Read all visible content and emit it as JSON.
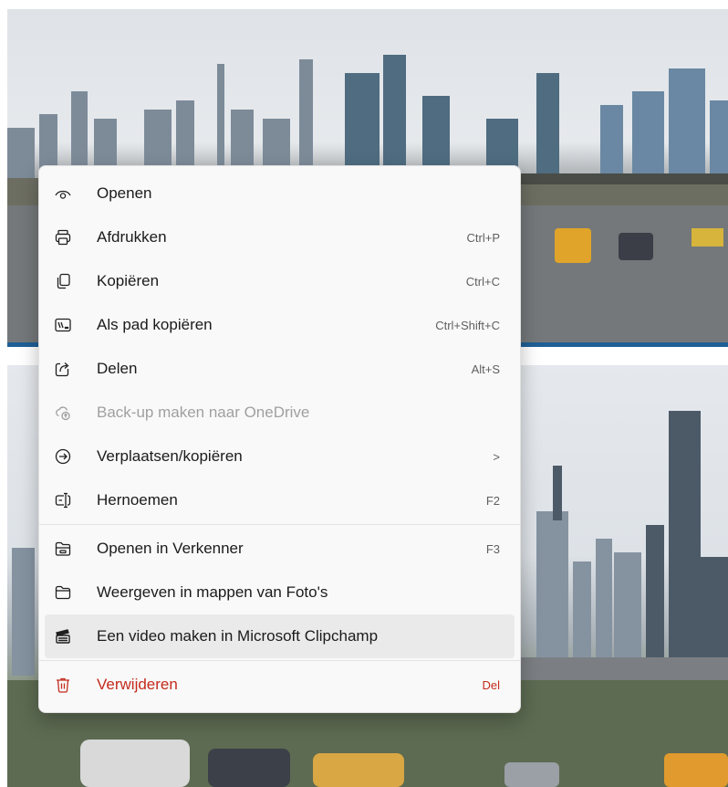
{
  "menu": {
    "items": [
      {
        "label": "Openen",
        "shortcut": "",
        "icon": "eye-icon"
      },
      {
        "label": "Afdrukken",
        "shortcut": "Ctrl+P",
        "icon": "printer-icon"
      },
      {
        "label": "Kopiëren",
        "shortcut": "Ctrl+C",
        "icon": "copy-icon"
      },
      {
        "label": "Als pad kopiëren",
        "shortcut": "Ctrl+Shift+C",
        "icon": "copy-path-icon"
      },
      {
        "label": "Delen",
        "shortcut": "Alt+S",
        "icon": "share-icon"
      },
      {
        "label": "Back-up maken naar OneDrive",
        "shortcut": "",
        "icon": "cloud-upload-icon",
        "disabled": true
      },
      {
        "label": "Verplaatsen/kopiëren",
        "shortcut": ">",
        "icon": "arrow-circle-icon"
      },
      {
        "label": "Hernoemen",
        "shortcut": "F2",
        "icon": "rename-icon"
      },
      {
        "label": "Openen in Verkenner",
        "shortcut": "F3",
        "icon": "folder-open-icon"
      },
      {
        "label": "Weergeven in mappen van Foto's",
        "shortcut": "",
        "icon": "folder-icon"
      },
      {
        "label": "Een video maken in Microsoft Clipchamp",
        "shortcut": "",
        "icon": "clipchamp-icon",
        "hovered": true
      },
      {
        "label": "Verwijderen",
        "shortcut": "Del",
        "icon": "trash-icon",
        "danger": true
      }
    ]
  },
  "colors": {
    "menu_background": "#f9f9f9",
    "hover_background": "#eaeaea",
    "danger": "#c42b1c",
    "disabled_text": "#a0a0a0",
    "accent_strip": "#1f5f96"
  }
}
